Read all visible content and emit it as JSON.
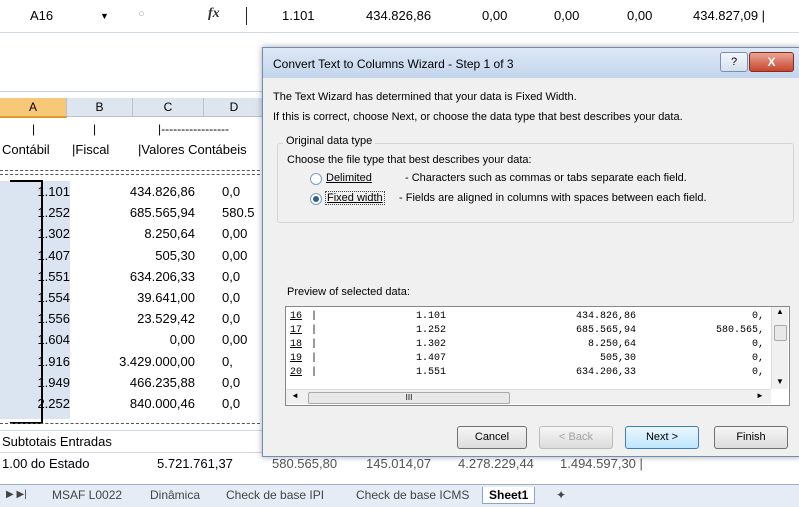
{
  "formula_bar": {
    "name_box": "A16",
    "fx_label": "fx",
    "values": [
      "1.101",
      "434.826,86",
      "0,00",
      "0,00",
      "0,00",
      "434.827,09 |"
    ]
  },
  "sheet": {
    "columns": [
      "A",
      "B",
      "C",
      "D"
    ],
    "header_row": {
      "a": "Contábil",
      "b": "|Fiscal",
      "c": "|Valores Contábeis"
    },
    "pipes_row": {
      "a": "|",
      "b": "|",
      "c": "|-----------------"
    },
    "rows": [
      {
        "a": "1.101",
        "c": "434.826,86",
        "d": "0,0"
      },
      {
        "a": "1.252",
        "c": "685.565,94",
        "d": "580.5"
      },
      {
        "a": "1.302",
        "c": "8.250,64",
        "d": "0,00"
      },
      {
        "a": "1.407",
        "c": "505,30",
        "d": "0,00"
      },
      {
        "a": "1.551",
        "c": "634.206,33",
        "d": "0,0"
      },
      {
        "a": "1.554",
        "c": "39.641,00",
        "d": "0,0"
      },
      {
        "a": "1.556",
        "c": "23.529,42",
        "d": "0,0"
      },
      {
        "a": "1.604",
        "c": "0,00",
        "d": "0,00"
      },
      {
        "a": "1.916",
        "c": "3.429.000,00",
        "d": "0,"
      },
      {
        "a": "1.949",
        "c": "466.235,88",
        "d": "0,0"
      },
      {
        "a": "2.252",
        "c": "840.000,46",
        "d": "0,0"
      }
    ],
    "subtotal_label": "Subtotais Entradas",
    "state_label": "1.00 do Estado",
    "state_value": "5.721.761,37",
    "state_tail": [
      "580.565,80",
      "145.014,07",
      "4.278.229,44",
      "1.494.597,30 |"
    ]
  },
  "dialog": {
    "title": "Convert Text to Columns Wizard - Step 1 of 3",
    "help": "?",
    "close": "X",
    "intro1": "The Text Wizard has determined that your data is Fixed Width.",
    "intro2": "If this is correct, choose Next, or choose the data type that best describes your data.",
    "group_label": "Original data type",
    "choose_label": "Choose the file type that best describes your data:",
    "option_delimited": "Delimited",
    "option_delimited_desc": "- Characters such as commas or tabs separate each field.",
    "option_fixed": "Fixed width",
    "option_fixed_desc": "- Fields are aligned in columns with spaces between each field.",
    "selected_option": "Fixed width",
    "preview_label": "Preview of selected data:",
    "preview_rows": [
      {
        "n": "16",
        "v1": "1.101",
        "v2": "434.826,86",
        "v3": "0,"
      },
      {
        "n": "17",
        "v1": "1.252",
        "v2": "685.565,94",
        "v3": "580.565,"
      },
      {
        "n": "18",
        "v1": "1.302",
        "v2": "8.250,64",
        "v3": "0,"
      },
      {
        "n": "19",
        "v1": "1.407",
        "v2": "505,30",
        "v3": "0,"
      },
      {
        "n": "20",
        "v1": "1.551",
        "v2": "634.206,33",
        "v3": "0,"
      }
    ],
    "scroll_thumb": "III",
    "buttons": {
      "cancel": "Cancel",
      "back": "< Back",
      "next": "Next >",
      "finish": "Finish"
    }
  },
  "tabs": [
    "MSAF L0022",
    "Dinâmica",
    "Check de base IPI",
    "Check de base ICMS",
    "Sheet1"
  ],
  "active_tab": "Sheet1"
}
